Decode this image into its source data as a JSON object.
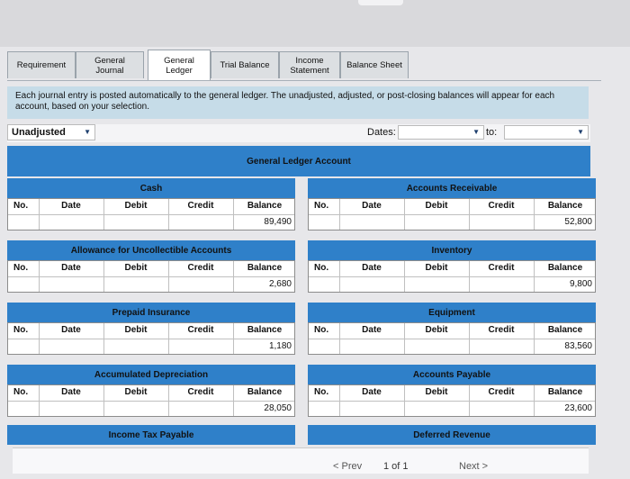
{
  "tabs": [
    {
      "label": "Requirement"
    },
    {
      "label": "General\nJournal"
    },
    {
      "label": "General\nLedger"
    },
    {
      "label": "Trial Balance"
    },
    {
      "label": "Income\nStatement"
    },
    {
      "label": "Balance Sheet"
    }
  ],
  "info": "Each journal entry is posted automatically to the general ledger. The unadjusted, adjusted, or post-closing balances will appear for each account, based on your selection.",
  "filter": {
    "selected": "Unadjusted",
    "dates_label": "Dates:",
    "to_label": "to:",
    "arrow": "▼"
  },
  "gl_title": "General Ledger Account",
  "columns": {
    "no": "No.",
    "date": "Date",
    "debit": "Debit",
    "credit": "Credit",
    "balance": "Balance"
  },
  "accounts": [
    {
      "name": "Cash",
      "balance": "89,490"
    },
    {
      "name": "Accounts Receivable",
      "balance": "52,800"
    },
    {
      "name": "Allowance for Uncollectible Accounts",
      "balance": "2,680"
    },
    {
      "name": "Inventory",
      "balance": "9,800"
    },
    {
      "name": "Prepaid Insurance",
      "balance": "1,180"
    },
    {
      "name": "Equipment",
      "balance": "83,560"
    },
    {
      "name": "Accumulated Depreciation",
      "balance": "28,050"
    },
    {
      "name": "Accounts Payable",
      "balance": "23,600"
    },
    {
      "name": "Income Tax Payable"
    },
    {
      "name": "Deferred Revenue"
    }
  ],
  "pager": {
    "prev": "< Prev",
    "page": "1 of 1",
    "next": "Next >"
  }
}
